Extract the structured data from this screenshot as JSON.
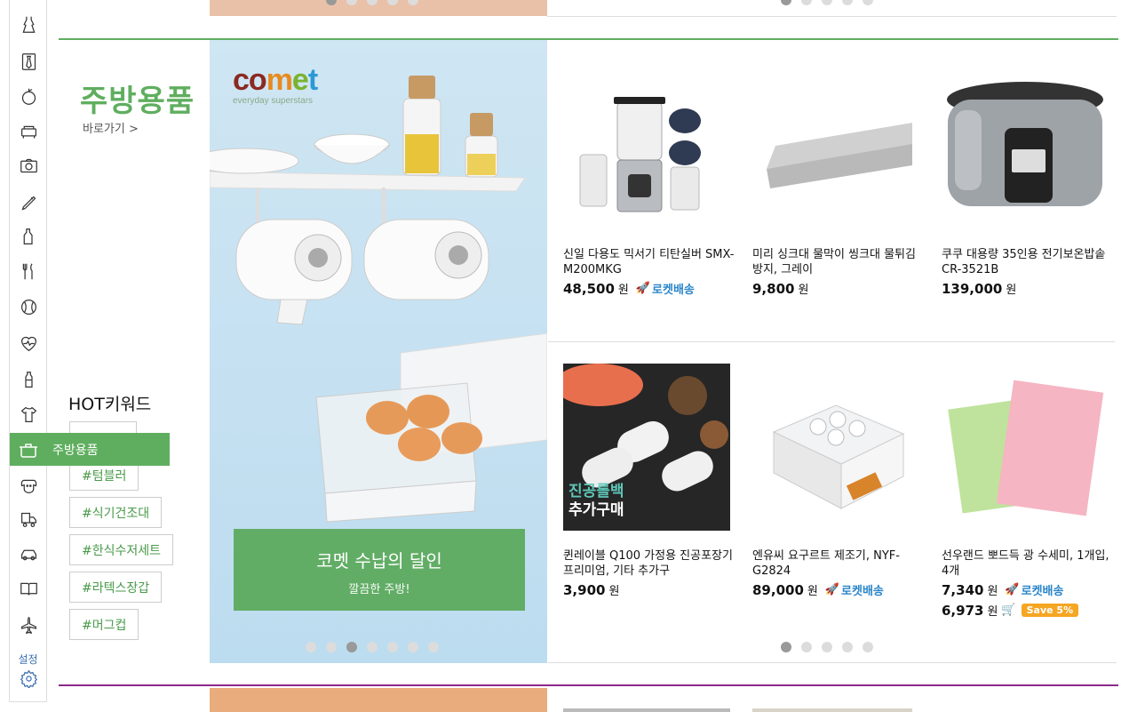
{
  "rail": {
    "icons": [
      "dress-icon",
      "tie-icon",
      "apple-icon",
      "sofa-icon",
      "camera-icon",
      "pencil-icon",
      "bottle-icon",
      "cutlery-icon",
      "ball-icon",
      "heart-pulse-icon",
      "baby-bottle-icon",
      "onesie-icon",
      "pot-icon",
      "dog-icon",
      "toy-truck-icon",
      "car-icon",
      "book-icon",
      "airplane-icon"
    ],
    "settings_label": "설정",
    "flyout_label": "주방용품"
  },
  "section": {
    "title": "주방용품",
    "shortcut": "바로가기 >",
    "hot_title": "HOT키워드",
    "keywords": [
      "#텀블러",
      "#식기건조대",
      "#한식수저세트",
      "#라텍스장갑",
      "#머그컵"
    ]
  },
  "banner": {
    "brand": "comet",
    "brand_sub": "everyday superstars",
    "headline": "코멧 수납의 달인",
    "subline": "깔끔한 주방!",
    "dots_total": 7,
    "dots_active": 3
  },
  "products": [
    {
      "name": "신일 다용도 믹서기 티탄실버 SMX-M200MKG",
      "price": "48,500",
      "won": "원",
      "rocket": "로켓배송"
    },
    {
      "name": "미리 싱크대 물막이 씽크대 물튀김방지, 그레이",
      "price": "9,800",
      "won": "원",
      "rocket": ""
    },
    {
      "name": "쿠쿠 대용량 35인용 전기보온밥솥 CR-3521B",
      "price": "139,000",
      "won": "원",
      "rocket": ""
    },
    {
      "name": "퀸레이블 Q100 가정용 진공포장기 프리미엄, 기타 추가구",
      "price": "3,900",
      "won": "원",
      "rocket": "",
      "img_text": "진공롤백\n추가구매"
    },
    {
      "name": "엔유씨 요구르트 제조기, NYF-G2824",
      "price": "89,000",
      "won": "원",
      "rocket": "로켓배송"
    },
    {
      "name": "선우랜드 뽀드득 광 수세미, 1개입, 4개",
      "price": "7,340",
      "won": "원",
      "rocket": "로켓배송",
      "price2": "6,973",
      "save": "Save 5%"
    }
  ],
  "product_dots": {
    "total": 5,
    "active": 1
  },
  "colors": {
    "accent_green": "#5fae5f",
    "rocket_blue": "#2a86c9",
    "divider_purple": "#8b2b8b",
    "save_orange": "#f5a623"
  }
}
